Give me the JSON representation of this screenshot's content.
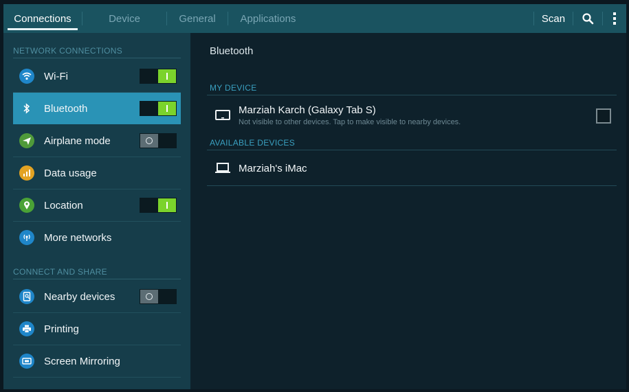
{
  "tabs": [
    {
      "label": "Connections",
      "active": true
    },
    {
      "label": "Device",
      "active": false
    },
    {
      "label": "General",
      "active": false
    },
    {
      "label": "Applications",
      "active": false
    }
  ],
  "actions": {
    "scan_label": "Scan",
    "search_icon": "search-icon",
    "overflow_icon": "more-vertical-icon"
  },
  "sidebar": {
    "network_header": "NETWORK CONNECTIONS",
    "connect_header": "CONNECT AND SHARE",
    "items": [
      {
        "label": "Wi-Fi",
        "icon": "wifi-icon",
        "color": "#1f86c9",
        "toggle": "on"
      },
      {
        "label": "Bluetooth",
        "icon": "bluetooth-icon",
        "color": "#2a93b6",
        "toggle": "on"
      },
      {
        "label": "Airplane mode",
        "icon": "airplane-icon",
        "color": "#4f9a3a",
        "toggle": "off"
      },
      {
        "label": "Data usage",
        "icon": "data-usage-icon",
        "color": "#e3a323",
        "toggle": null
      },
      {
        "label": "Location",
        "icon": "location-icon",
        "color": "#4aa236",
        "toggle": "on"
      },
      {
        "label": "More networks",
        "icon": "more-networks-icon",
        "color": "#1f86c9",
        "toggle": null
      },
      {
        "label": "Nearby devices",
        "icon": "nearby-devices-icon",
        "color": "#1f86c9",
        "toggle": "off"
      },
      {
        "label": "Printing",
        "icon": "printer-icon",
        "color": "#1f86c9",
        "toggle": null
      },
      {
        "label": "Screen Mirroring",
        "icon": "screen-mirroring-icon",
        "color": "#1f86c9",
        "toggle": null
      }
    ],
    "selected_index": 1
  },
  "main": {
    "title": "Bluetooth",
    "my_device_header": "MY DEVICE",
    "my_device": {
      "name": "Marziah Karch (Galaxy Tab S)",
      "subtitle": "Not visible to other devices. Tap to make visible to nearby devices.",
      "visible": false
    },
    "available_header": "AVAILABLE DEVICES",
    "available": [
      {
        "name": "Marziah's iMac",
        "icon": "laptop-icon"
      }
    ]
  }
}
